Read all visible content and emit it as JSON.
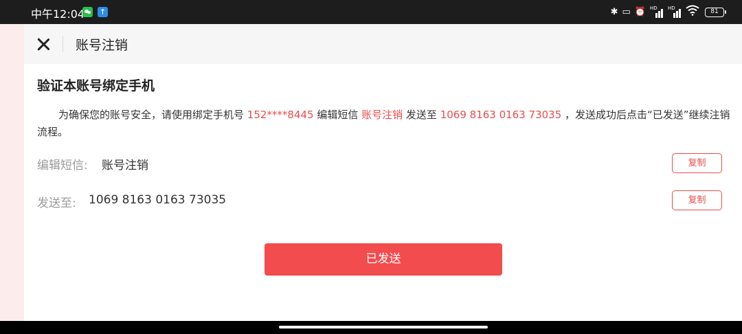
{
  "status_bar": {
    "time": "中午12:04",
    "battery": "81",
    "signal_label_1": "HD",
    "signal_label_2": "HD",
    "icons": [
      "wechat-icon",
      "app-notification-icon",
      "bluetooth-icon",
      "vibrate-icon",
      "alarm-icon",
      "signal-icon",
      "signal-icon",
      "wifi-icon",
      "battery-icon"
    ]
  },
  "header": {
    "title": "账号注销"
  },
  "main": {
    "heading": "验证本账号绑定手机",
    "instruction": {
      "part1": "为确保您的账号安全，请使用绑定手机号 ",
      "phone": "152****8445",
      "part2": " 编辑短信 ",
      "sms_content": "账号注销",
      "part3": " 发送至 ",
      "target_number": "1069 8163 0163 73035",
      "part4": " ，发送成功后点击“已发送”继续注销流程。"
    },
    "rows": [
      {
        "label": "编辑短信:",
        "value": "账号注销",
        "button": "复制"
      },
      {
        "label": "发送至:",
        "value": "1069 8163 0163 73035",
        "button": "复制"
      }
    ],
    "sent_button": "已发送"
  },
  "colors": {
    "accent": "#e84c4c",
    "primary_button": "#f24c4e",
    "title_bar_bg": "#f6f6f6"
  }
}
